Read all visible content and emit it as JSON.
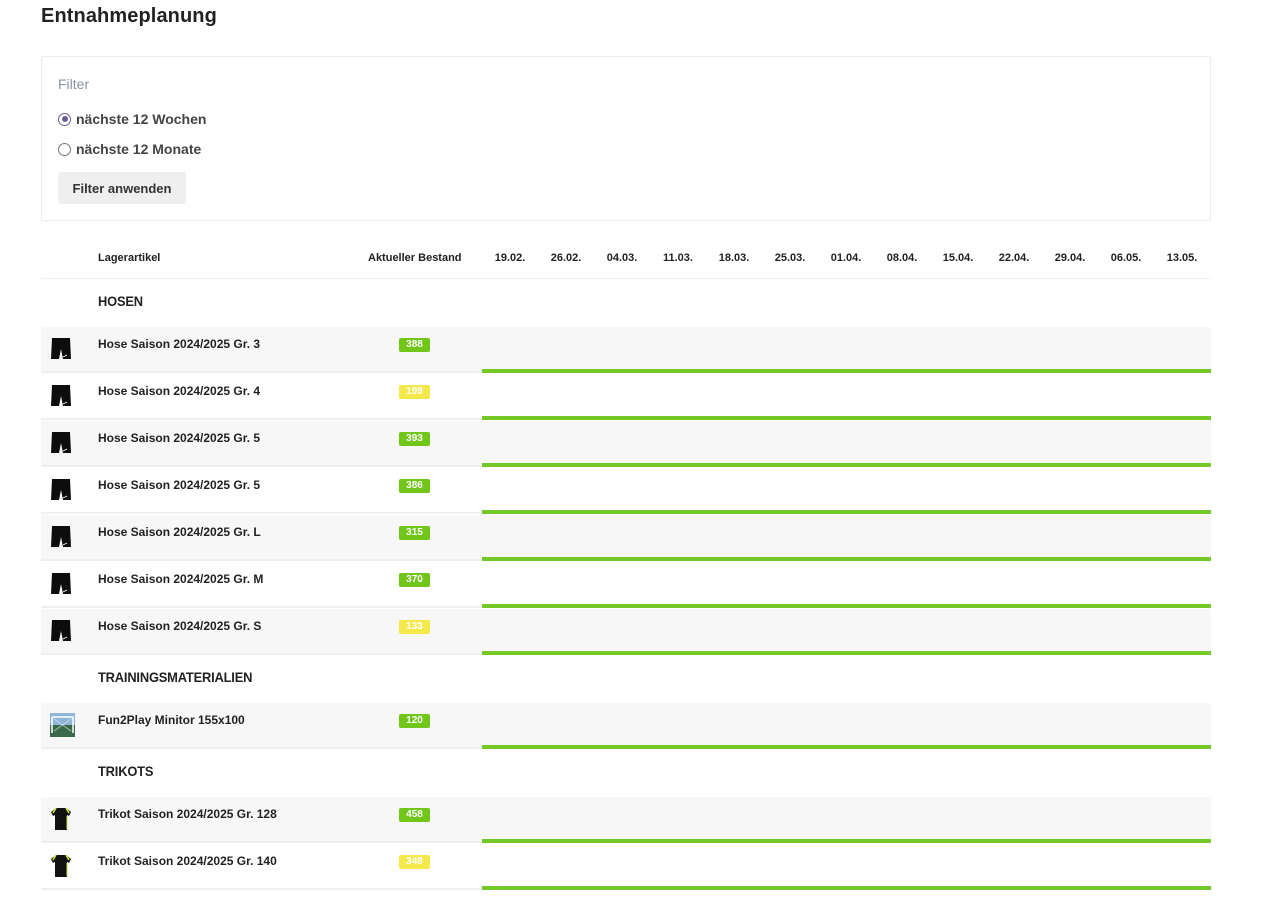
{
  "page": {
    "title": "Entnahmeplanung"
  },
  "filter": {
    "title": "Filter",
    "options": [
      {
        "label": "nächste 12 Wochen",
        "checked": true
      },
      {
        "label": "nächste 12 Monate",
        "checked": false
      }
    ],
    "apply_label": "Filter anwenden"
  },
  "table": {
    "headers": {
      "article": "Lagerartikel",
      "stock": "Aktueller Bestand",
      "dates": [
        "19.02.",
        "26.02.",
        "04.03.",
        "11.03.",
        "18.03.",
        "25.03.",
        "01.04.",
        "08.04.",
        "15.04.",
        "22.04.",
        "29.04.",
        "06.05.",
        "13.05."
      ]
    },
    "groups": [
      {
        "title": "HOSEN",
        "items": [
          {
            "name": "Hose Saison 2024/2025 Gr. 3",
            "stock": "388",
            "status": "green",
            "icon": "shorts-icon"
          },
          {
            "name": "Hose Saison 2024/2025 Gr. 4",
            "stock": "199",
            "status": "yellow",
            "icon": "shorts-icon"
          },
          {
            "name": "Hose Saison 2024/2025 Gr. 5",
            "stock": "393",
            "status": "green",
            "icon": "shorts-icon"
          },
          {
            "name": "Hose Saison 2024/2025 Gr. 5",
            "stock": "386",
            "status": "green",
            "icon": "shorts-icon"
          },
          {
            "name": "Hose Saison 2024/2025 Gr. L",
            "stock": "315",
            "status": "green",
            "icon": "shorts-icon"
          },
          {
            "name": "Hose Saison 2024/2025 Gr. M",
            "stock": "370",
            "status": "green",
            "icon": "shorts-icon"
          },
          {
            "name": "Hose Saison 2024/2025 Gr. S",
            "stock": "133",
            "status": "yellow",
            "icon": "shorts-icon"
          }
        ]
      },
      {
        "title": "TRAININGSMATERIALIEN",
        "items": [
          {
            "name": "Fun2Play Minitor 155x100",
            "stock": "120",
            "status": "green",
            "icon": "goal-icon"
          }
        ]
      },
      {
        "title": "TRIKOTS",
        "items": [
          {
            "name": "Trikot Saison 2024/2025 Gr. 128",
            "stock": "458",
            "status": "green",
            "icon": "jersey-icon"
          },
          {
            "name": "Trikot Saison 2024/2025 Gr. 140",
            "stock": "348",
            "status": "yellow",
            "icon": "jersey-icon"
          }
        ]
      }
    ]
  },
  "colors": {
    "green": "#72c61a",
    "yellow": "#f5e84a",
    "radio_accent": "#6b5b95",
    "timeline": "#76c828"
  }
}
